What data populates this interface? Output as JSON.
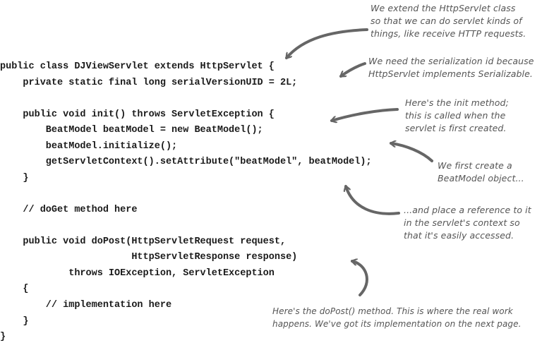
{
  "code": {
    "lines": [
      "public class DJViewServlet extends HttpServlet {",
      "    private static final long serialVersionUID = 2L;",
      "",
      "    public void init() throws ServletException {",
      "        BeatModel beatModel = new BeatModel();",
      "        beatModel.initialize();",
      "        getServletContext().setAttribute(\"beatModel\", beatModel);",
      "    }",
      "",
      "    // doGet method here",
      "",
      "    public void doPost(HttpServletRequest request,",
      "                       HttpServletResponse response)",
      "            throws IOException, ServletException",
      "    {",
      "        // implementation here",
      "    }",
      "}"
    ]
  },
  "annotations": {
    "extend": [
      "We extend the HttpServlet class",
      "so that we can do servlet kinds of",
      "things, like receive HTTP requests."
    ],
    "serial": [
      "We need the serialization id because",
      "HttpServlet implements Serializable."
    ],
    "init": [
      "Here's the init method;",
      "this is called when the",
      "servlet is first created."
    ],
    "beatmodel": [
      "We first create a",
      "BeatModel object..."
    ],
    "context": [
      "...and place a reference to it",
      "in the servlet's context so",
      "that it's easily accessed."
    ],
    "dopost": [
      "Here's the doPost() method. This is where the real work",
      "happens. We've got its implementation on the next page."
    ]
  },
  "colors": {
    "code": "#1a1a1a",
    "annotation": "#555555",
    "arrow": "#666666"
  }
}
